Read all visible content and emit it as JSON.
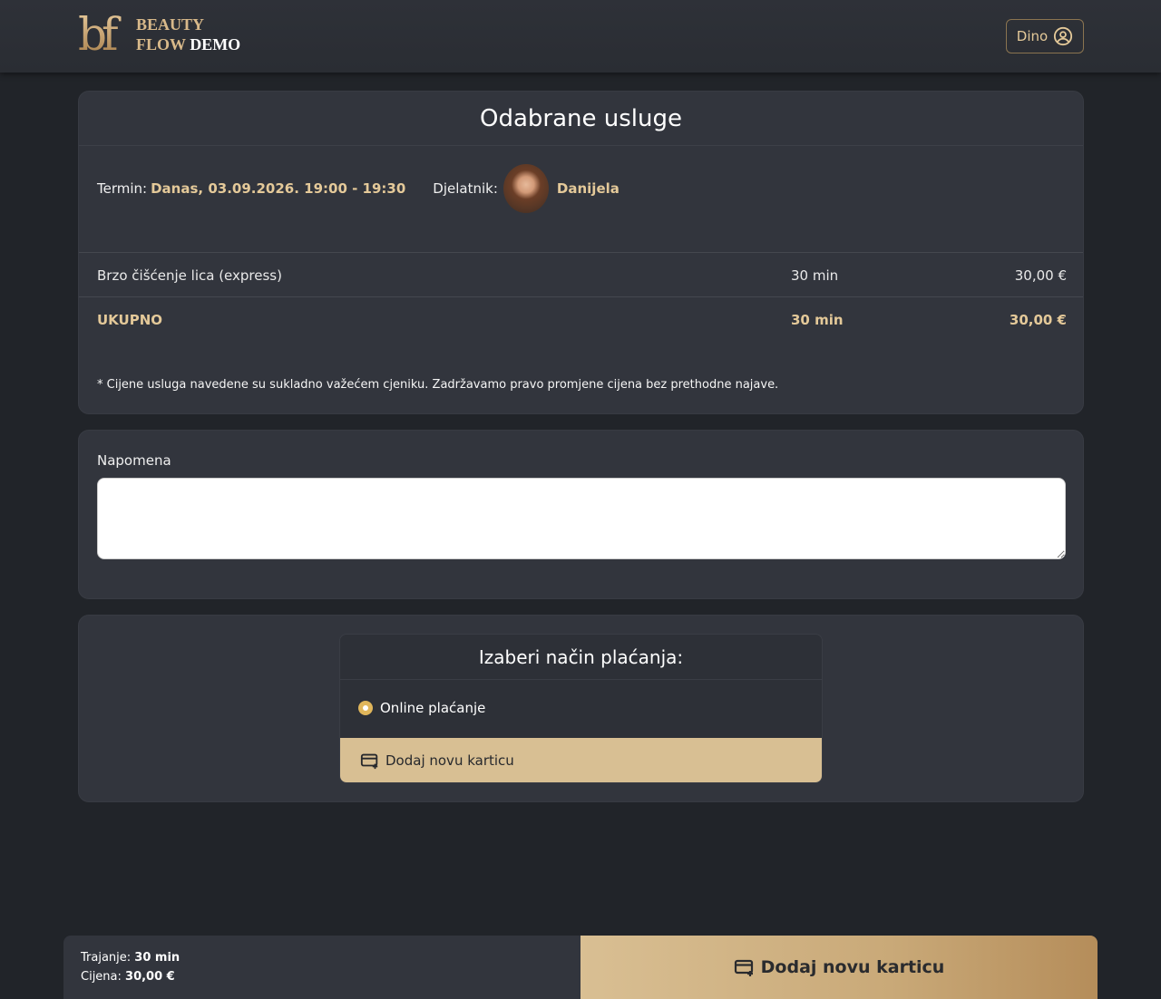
{
  "header": {
    "logo_mark": "bf",
    "logo_line1": "BEAUTY",
    "logo_line2_a": "FLOW",
    "logo_line2_b": "DEMO",
    "user_name": "Dino",
    "user_icon": "user-circle-icon"
  },
  "summary": {
    "title": "Odabrane usluge",
    "term_label": "Termin:",
    "term_value": "Danas, 03.09.2026. 19:00 - 19:30",
    "worker_label": "Djelatnik:",
    "worker_name": "Danijela",
    "services": [
      {
        "name": "Brzo čišćenje lica (express)",
        "duration": "30 min",
        "price": "30,00 €"
      }
    ],
    "total": {
      "label": "UKUPNO",
      "duration": "30 min",
      "price": "30,00 €"
    },
    "disclaimer": "* Cijene usluga navedene su sukladno važećem cjeniku. Zadržavamo pravo promjene cijena bez prethodne najave."
  },
  "note": {
    "label": "Napomena",
    "value": ""
  },
  "payment": {
    "title": "Izaberi način plaćanja:",
    "option_label": "Online plaćanje",
    "add_card_label": "Dodaj novu karticu",
    "add_card_icon": "credit-card-plus-icon"
  },
  "footer": {
    "duration_label": "Trajanje:",
    "duration_value": "30 min",
    "price_label": "Cijena:",
    "price_value": "30,00 €",
    "cta_label": "Dodaj novu karticu"
  },
  "colors": {
    "accent": "#e4c999",
    "button": "#d8bf93",
    "background": "#212429",
    "card": "#32353d"
  }
}
